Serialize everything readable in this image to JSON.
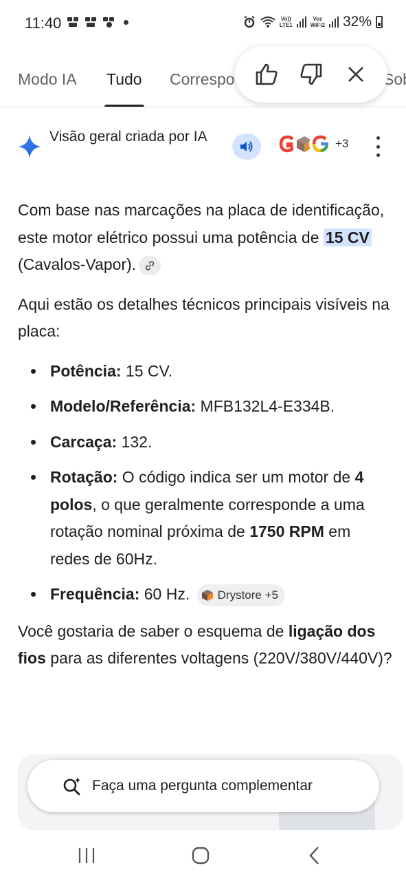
{
  "status_bar": {
    "time": "11:40",
    "battery": "32%",
    "net1_top": "Vo))",
    "net1_bottom": "LTE1",
    "net2_top": "Voz",
    "net2_bottom": "WiFi2"
  },
  "tabs": {
    "items": [
      {
        "label": "Modo IA"
      },
      {
        "label": "Tudo"
      },
      {
        "label": "Correspo"
      },
      {
        "label": "Sob"
      }
    ],
    "active": "Tudo"
  },
  "feedback": {
    "like_icon": "thumbs-up-icon",
    "dislike_icon": "thumbs-down-icon",
    "close_icon": "close-icon"
  },
  "ai_overview": {
    "title": "Visão geral criada por IA",
    "sources_more": "+3",
    "speaker_icon": "speaker-icon",
    "accent": "#d3e3fd"
  },
  "content": {
    "p1_before": "Com base nas marcações na placa de identificação, este motor elétrico possui uma potência de ",
    "p1_highlight": "15 CV",
    "p1_after": " (Cavalos-Vapor).",
    "p2": "Aqui estão os detalhes técnicos principais visíveis na placa:",
    "items": [
      {
        "label": "Potência:",
        "text": " 15 CV."
      },
      {
        "label": "Modelo/Referência:",
        "text": " MFB132L4-E334B."
      },
      {
        "label": "Carcaça:",
        "text": " 132."
      }
    ],
    "rotation": {
      "label": "Rotação:",
      "t1": " O código indica ser um motor de ",
      "b1": "4 polos",
      "t2": ", o que geralmente corresponde a uma rotação nominal próxima de ",
      "b2": "1750 RPM",
      "t3": " em redes de 60Hz."
    },
    "frequency": {
      "label": "Frequência:",
      "text": " 60 Hz.",
      "source_chip": "Drystore +5"
    },
    "p3_before": "Você gostaria de saber o esquema de ",
    "p3_bold": "ligação dos fios",
    "p3_after": " para as diferentes voltagens (220V/380V/440V)?"
  },
  "ask_bar": {
    "label": "Faça uma pergunta complementar"
  }
}
